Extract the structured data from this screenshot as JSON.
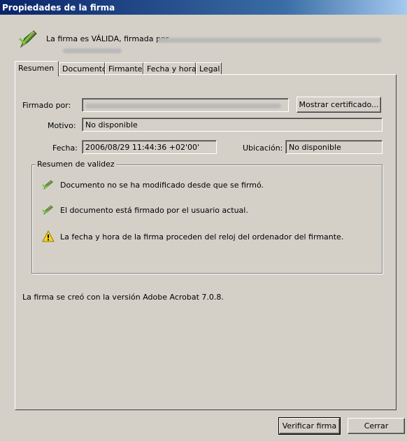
{
  "window": {
    "title": "Propiedades de la firma"
  },
  "header": {
    "status_text": "La firma es VÁLIDA, firmada por"
  },
  "tabs": [
    {
      "label": "Resumen"
    },
    {
      "label": "Documento"
    },
    {
      "label": "Firmante"
    },
    {
      "label": "Fecha y hora"
    },
    {
      "label": "Legal"
    }
  ],
  "summary": {
    "signed_by_label": "Firmado por:",
    "show_certificate_label": "Mostrar certificado...",
    "reason_label": "Motivo:",
    "reason_value": "No disponible",
    "date_label": "Fecha:",
    "date_value": "2006/08/29 11:44:36 +02'00'",
    "location_label": "Ubicación:",
    "location_value": "No disponible"
  },
  "validity": {
    "title": "Resumen de validez",
    "items": [
      {
        "icon": "pen-check-icon",
        "text": "Documento no se ha modificado desde que se firmó."
      },
      {
        "icon": "pen-check-icon",
        "text": "El documento está firmado por el usuario actual."
      },
      {
        "icon": "warning-icon",
        "text": "La fecha y hora de la firma proceden del reloj del ordenador del firmante."
      }
    ]
  },
  "version_text": "La firma se creó con la versión Adobe Acrobat 7.0.8.",
  "footer": {
    "verify_label": "Verificar firma",
    "close_label": "Cerrar"
  },
  "colors": {
    "titlebar_start": "#0a246a",
    "titlebar_end": "#a6caf0",
    "face": "#d4d0c8"
  }
}
